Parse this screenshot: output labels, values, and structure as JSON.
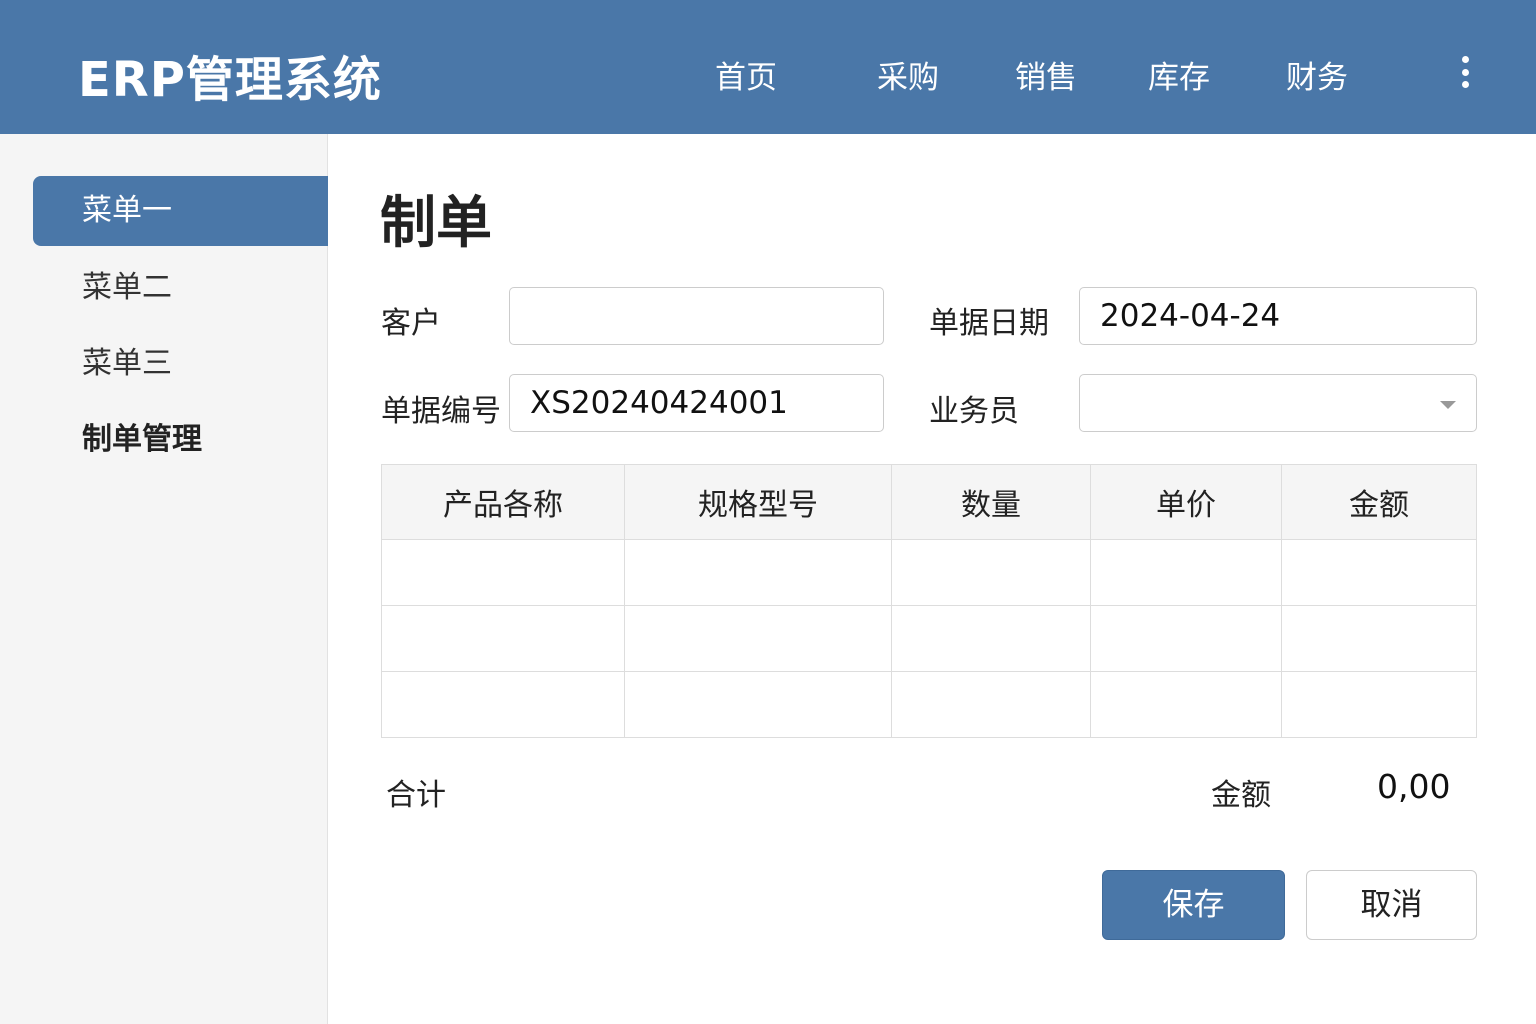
{
  "header": {
    "title": "ERP管理系统",
    "nav": [
      "首页",
      "采购",
      "销售",
      "库存",
      "财务"
    ]
  },
  "sidebar": {
    "items": [
      "菜单一",
      "菜单二",
      "菜单三",
      "制单管理"
    ]
  },
  "page": {
    "title": "制单"
  },
  "form": {
    "customer_label": "客户",
    "customer_value": "",
    "date_label": "单据日期",
    "date_value": "2024-04-24",
    "number_label": "单据编号",
    "number_value": "XS20240424001",
    "salesperson_label": "业务员",
    "salesperson_value": ""
  },
  "table": {
    "headers": [
      "产品各称",
      "规格型号",
      "数量",
      "单价",
      "金额"
    ],
    "rows": [
      [
        "",
        "",
        "",
        "",
        ""
      ],
      [
        "",
        "",
        "",
        "",
        ""
      ],
      [
        "",
        "",
        "",
        "",
        ""
      ]
    ]
  },
  "summary": {
    "total_label": "合计",
    "amount_label": "金额",
    "amount_value": "0,00"
  },
  "buttons": {
    "save": "保存",
    "cancel": "取消"
  }
}
